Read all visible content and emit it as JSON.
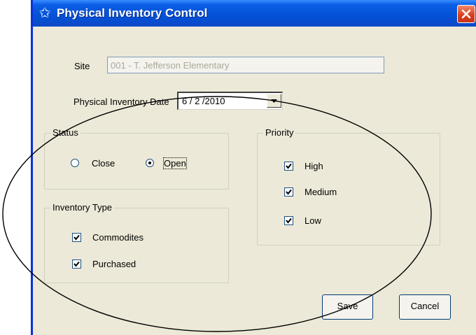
{
  "window": {
    "title": "Physical Inventory Control",
    "icon": "star-icon",
    "close_icon": "close-icon"
  },
  "site": {
    "label": "Site",
    "value": "001 - T. Jefferson Elementary"
  },
  "inventory_date": {
    "label": "Physical Inventory Date",
    "value": "6 / 2 /2010"
  },
  "status": {
    "legend": "Status",
    "options": [
      {
        "label": "Close",
        "selected": false
      },
      {
        "label": "Open",
        "selected": true
      }
    ]
  },
  "inventory_type": {
    "legend": "Inventory Type",
    "options": [
      {
        "label": "Commodites",
        "checked": true
      },
      {
        "label": "Purchased",
        "checked": true
      }
    ]
  },
  "priority": {
    "legend": "Priority",
    "options": [
      {
        "label": "High",
        "checked": true
      },
      {
        "label": "Medium",
        "checked": true
      },
      {
        "label": "Low",
        "checked": true
      }
    ]
  },
  "buttons": {
    "save": "Save",
    "cancel": "Cancel"
  },
  "colors": {
    "titlebar": "#0451d6",
    "window_bg": "#ece9d8",
    "close_button": "#d8421f"
  }
}
